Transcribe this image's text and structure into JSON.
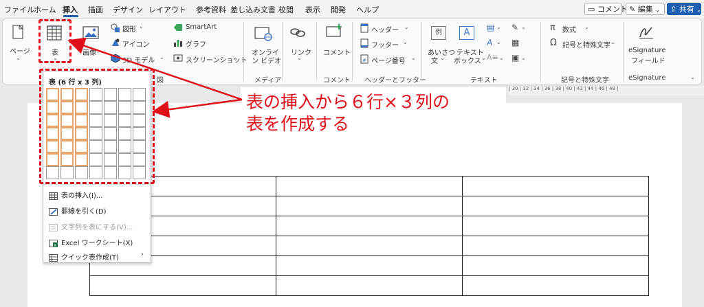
{
  "tabs": [
    {
      "label": "ファイル",
      "active": false
    },
    {
      "label": "ホーム",
      "active": false
    },
    {
      "label": "挿入",
      "active": true
    },
    {
      "label": "描画",
      "active": false
    },
    {
      "label": "デザイン",
      "active": false
    },
    {
      "label": "レイアウト",
      "active": false
    },
    {
      "label": "参考資料",
      "active": false
    },
    {
      "label": "差し込み文書",
      "active": false
    },
    {
      "label": "校閲",
      "active": false
    },
    {
      "label": "表示",
      "active": false
    },
    {
      "label": "開発",
      "active": false
    },
    {
      "label": "ヘルプ",
      "active": false
    }
  ],
  "topright": {
    "comment": "コメント",
    "edit": "編集",
    "share": "共有"
  },
  "ribbon": {
    "pages": "ページ",
    "table": "表",
    "image": "画像",
    "shapes": "図形",
    "icons": "アイコン",
    "model3d": "3D モデル",
    "smartart": "SmartArt",
    "graph": "グラフ",
    "screenshot": "スクリーンショット",
    "online_video_1": "オンライ",
    "online_video_2": "ン ビデオ",
    "link": "リンク",
    "comment": "コメント",
    "header": "ヘッダー",
    "footer": "フッター",
    "page_number": "ページ番号",
    "textbox_1": "テキスト",
    "textbox_2": "ボックス",
    "greeting_1": "あいさつ",
    "greeting_2": "文",
    "greeting_icon": "例",
    "equation": "数式",
    "symbol": "記号と特殊文字",
    "esig_1": "eSignature",
    "esig_2": "フィールド",
    "groups": {
      "illustration": "図",
      "media": "メディア",
      "comment": "コメント",
      "header_footer": "ヘッダーとフッター",
      "text": "テキスト",
      "symbol": "記号と特殊文字",
      "esig": "eSignature"
    }
  },
  "ruler": "| 30 | 32 | 34 | 36 | 38 | 40 | 42 | 44 | 46 | 48 |",
  "popup": {
    "grid_title": "表 (6 行 x 3 列)",
    "rows_selected": 6,
    "cols_selected": 3,
    "grid_rows": 7,
    "grid_cols": 7,
    "menu": [
      {
        "label": "表の挿入(I)...",
        "icon": "table-icon",
        "disabled": false
      },
      {
        "label": "罫線を引く(D)",
        "icon": "pencil-table-icon",
        "disabled": false
      },
      {
        "label": "文字列を表にする(V)...",
        "icon": "text-to-table-icon",
        "disabled": true
      },
      {
        "label": "Excel ワークシート(X)",
        "icon": "excel-icon",
        "disabled": false
      },
      {
        "label": "クイック表作成(T)",
        "icon": "quick-table-icon",
        "disabled": false
      }
    ]
  },
  "annotation": {
    "line1": "表の挿入から６行×３列の",
    "line2": "表を作成する",
    "color": "#e0101a"
  },
  "doc_table": {
    "rows": 6,
    "cols": 3
  }
}
